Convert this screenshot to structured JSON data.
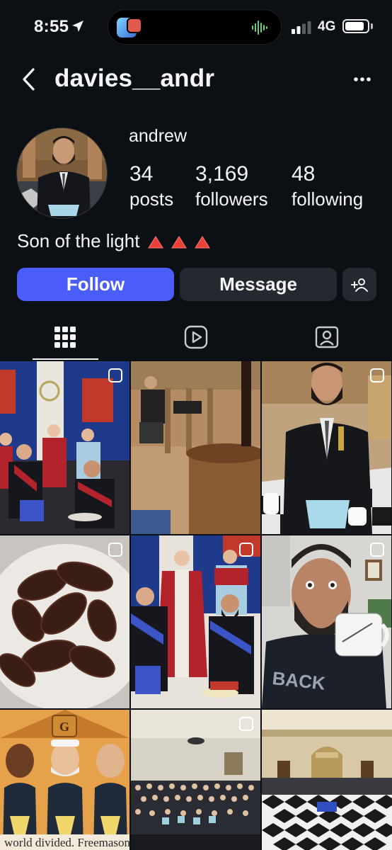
{
  "status_bar": {
    "time": "8:55",
    "network": "4G",
    "battery_level": 0.85,
    "signal_bars_filled": 2
  },
  "header": {
    "username": "davies__andr",
    "back_icon": "chevron-left-icon",
    "more_icon": "ellipsis-icon"
  },
  "profile": {
    "display_name": "andrew",
    "stats": [
      {
        "value": "34",
        "label": "posts"
      },
      {
        "value": "3,169",
        "label": "followers"
      },
      {
        "value": "48",
        "label": "following"
      }
    ],
    "bio": "Son of the light",
    "bio_emoji_count": 3,
    "bio_emoji": "red-triangle-icon"
  },
  "actions": {
    "follow_label": "Follow",
    "message_label": "Message",
    "add_person_icon": "add-person-icon"
  },
  "tabs": [
    {
      "icon": "grid-icon",
      "active": true
    },
    {
      "icon": "reels-icon",
      "active": false
    },
    {
      "icon": "tagged-icon",
      "active": false
    }
  ],
  "colors": {
    "background": "#0c0f14",
    "follow_button": "#4a5df9",
    "secondary_button": "#25282f",
    "text": "#f4f5f7"
  },
  "grid_posts": [
    {
      "name": "lodge-group-photo",
      "multi": true
    },
    {
      "name": "lodge-room-gavel",
      "multi": false
    },
    {
      "name": "man-in-regalia-portrait",
      "multi": true
    },
    {
      "name": "crabs-in-bowl",
      "multi": true
    },
    {
      "name": "lodge-group-seated",
      "multi": true
    },
    {
      "name": "selfie-with-mug",
      "multi": true
    },
    {
      "name": "cartoon-three-men",
      "multi": false,
      "caption": "world divided. Freemasonry rem"
    },
    {
      "name": "lodge-large-group",
      "multi": true
    },
    {
      "name": "lodge-hall-interior",
      "multi": false
    }
  ]
}
